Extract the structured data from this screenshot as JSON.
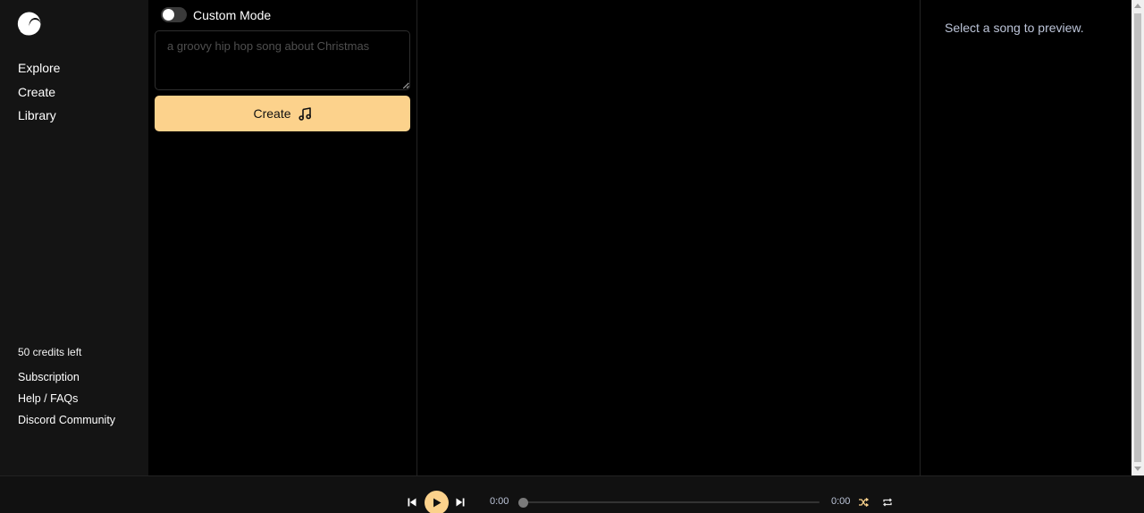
{
  "sidebar": {
    "logo_icon": "suno-wave-logo-icon",
    "nav": [
      {
        "label": "Explore"
      },
      {
        "label": "Create"
      },
      {
        "label": "Library"
      }
    ],
    "credits": "50 credits left",
    "links": [
      {
        "label": "Subscription"
      },
      {
        "label": "Help / FAQs"
      },
      {
        "label": "Discord Community"
      }
    ]
  },
  "create": {
    "mode_label": "Custom Mode",
    "mode_on": false,
    "prompt_placeholder": "a groovy hip hop song about Christmas",
    "prompt_value": "",
    "button_label": "Create",
    "button_icon": "music-note-icon"
  },
  "preview": {
    "message": "Select a song to preview."
  },
  "player": {
    "elapsed": "0:00",
    "duration": "0:00",
    "progress": 0,
    "icons": [
      "previous-icon",
      "play-icon",
      "next-icon",
      "shuffle-icon",
      "repeat-icon"
    ]
  },
  "colors": {
    "accent": "#fcd28c",
    "sidebar_bg": "#141414",
    "muted_text": "#bcc4d8"
  }
}
